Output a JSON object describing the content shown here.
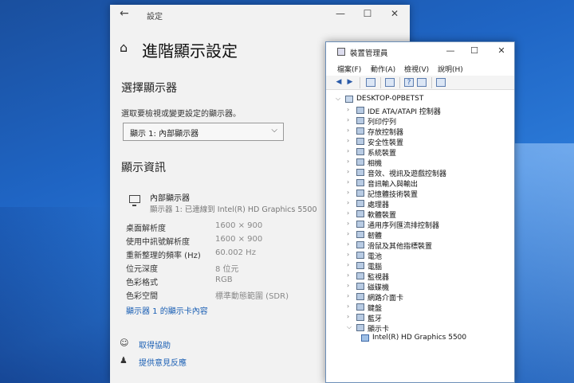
{
  "settings": {
    "app_title": "設定",
    "back_glyph": "←",
    "minimize_glyph": "—",
    "maximize_glyph": "☐",
    "close_glyph": "✕",
    "home_glyph": "⌂",
    "page_title": "進階顯示設定",
    "choose_heading": "選擇顯示器",
    "choose_prompt": "選取要檢視或變更設定的顯示器。",
    "selected_display": "顯示 1: 內部顯示器",
    "chevron_glyph": "⌵",
    "info_heading": "顯示資訊",
    "monitor_name": "內部顯示器",
    "monitor_sub": "顯示器 1: 已連線到 Intel(R) HD Graphics 5500",
    "info_rows": [
      {
        "label": "桌面解析度",
        "value": "1600 × 900"
      },
      {
        "label": "使用中訊號解析度",
        "value": "1600 × 900"
      },
      {
        "label": "重新整理的頻率 (Hz)",
        "value": "60.002 Hz"
      },
      {
        "label": "位元深度",
        "value": "8 位元"
      },
      {
        "label": "色彩格式",
        "value": "RGB"
      },
      {
        "label": "色彩空間",
        "value": "標準動態範圍 (SDR)"
      }
    ],
    "adapter_link": "顯示器 1 的顯示卡內容",
    "help_link": "取得協助",
    "feedback_link": "提供意見反應",
    "help_glyph": "☺",
    "feedback_glyph": "♟"
  },
  "devmgr": {
    "title": "裝置管理員",
    "minimize_glyph": "—",
    "maximize_glyph": "☐",
    "close_glyph": "✕",
    "menus": [
      "檔案(F)",
      "動作(A)",
      "檢視(V)",
      "說明(H)"
    ],
    "toolbar": {
      "back": "◀",
      "forward": "▶",
      "help": "?"
    },
    "root": "DESKTOP-0PBETST",
    "expanded_arrow": "⌵",
    "collapsed_arrow": "›",
    "categories": [
      "IDE ATA/ATAPI 控制器",
      "列印佇列",
      "存放控制器",
      "安全性裝置",
      "系統裝置",
      "相機",
      "音效、視訊及遊戲控制器",
      "音訊輸入與輸出",
      "記憶體技術裝置",
      "處理器",
      "軟體裝置",
      "通用序列匯流排控制器",
      "韌體",
      "滑鼠及其他指標裝置",
      "電池",
      "電腦",
      "監視器",
      "磁碟機",
      "網路介面卡",
      "鍵盤",
      "藍牙",
      "顯示卡"
    ],
    "display_child": "Intel(R) HD Graphics 5500"
  }
}
